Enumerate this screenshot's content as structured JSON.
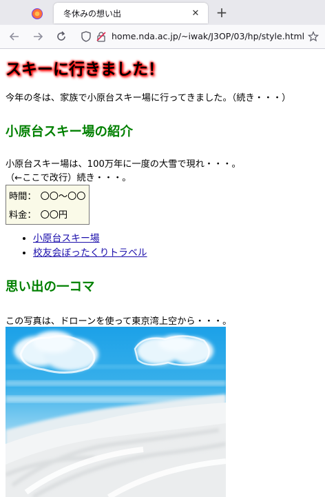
{
  "browser": {
    "tab_title": "冬休みの想い出",
    "tab_close": "✕",
    "new_tab": "+",
    "url": "home.nda.ac.jp/~iwak/J3OP/03/hp/style.html"
  },
  "page": {
    "heading": "スキーに行きました！",
    "intro": "今年の冬は、家族で小原台スキー場に行ってきました。（続き・・・）",
    "section1_title": "小原台スキー場の紹介",
    "section1_line1": "小原台スキー場は、100万年に一度の大雪で現れ・・・。",
    "section1_line2": "（←ここで改行）続き・・・。",
    "table": [
      {
        "label": "時間：",
        "value": "〇〇～〇〇"
      },
      {
        "label": "料金：",
        "value": "〇〇円"
      }
    ],
    "links": [
      "小原台スキー場",
      "校友会ぼったくりトラベル"
    ],
    "section2_title": "思い出の一コマ",
    "photo_caption": "この写真は、ドローンを使って東京湾上空から・・・。"
  },
  "colors": {
    "heading_glow": "#ff0000",
    "section_title": "#008000",
    "link": "#1a0dab",
    "sky": "#35a7e3"
  }
}
